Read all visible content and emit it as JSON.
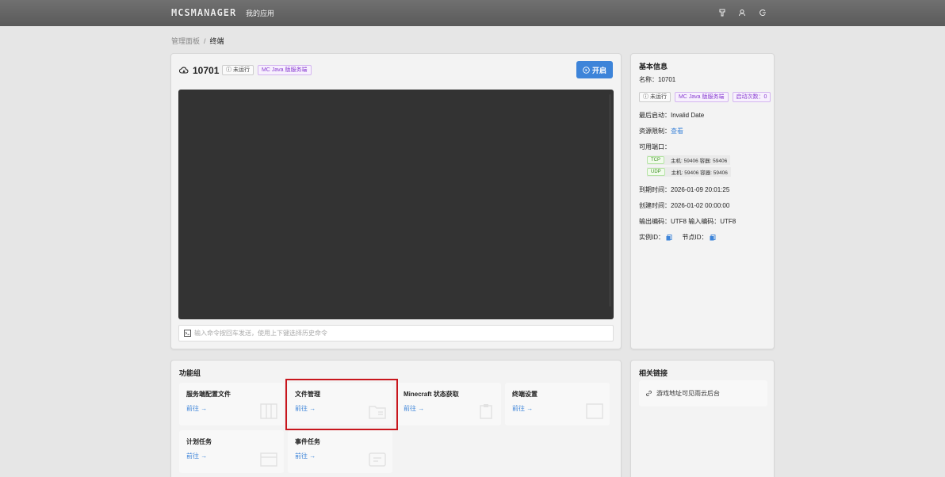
{
  "header": {
    "logo": "MCSMANAGER",
    "nav_apps": "我的应用"
  },
  "breadcrumb": {
    "root": "管理面板",
    "sep": "/",
    "current": "终端"
  },
  "instance": {
    "name": "10701",
    "status": "未运行",
    "type": "MC Java 版服务端",
    "start_label": "开启",
    "command_placeholder": "输入命令按回车发送，使用上下键选择历史命令"
  },
  "info": {
    "title": "基本信息",
    "name_line": "名称：10701",
    "status": "未运行",
    "type": "MC Java 版服务端",
    "start_count": "启动次数：0",
    "last_start": "最后启动：Invalid Date",
    "resource_label": "资源限制：",
    "resource_link": "查看",
    "ports_label": "可用端口：",
    "ports": [
      {
        "proto": "TCP",
        "desc": "主机: 59406 容器: 59406"
      },
      {
        "proto": "UDP",
        "desc": "主机: 59406 容器: 59406"
      }
    ],
    "expire": "到期时间：2026-01-09 20:01:25",
    "created": "创建时间：2026-01-02 00:00:00",
    "encoding": "输出编码：UTF8  输入编码：UTF8",
    "instance_id": "实例ID：",
    "node_id": "节点ID："
  },
  "features": {
    "title": "功能组",
    "go_label": "前往 →",
    "items": [
      {
        "title": "服务端配置文件",
        "icon": "columns-icon"
      },
      {
        "title": "文件管理",
        "icon": "folder-icon"
      },
      {
        "title": "Minecraft 状态获取",
        "icon": "clipboard-icon"
      },
      {
        "title": "终端设置",
        "icon": "square-icon"
      },
      {
        "title": "计划任务",
        "icon": "calendar-icon"
      },
      {
        "title": "事件任务",
        "icon": "event-icon"
      }
    ]
  },
  "links": {
    "title": "相关链接",
    "item": "游戏地址可见雨云后台"
  },
  "colors": {
    "accent": "#3d84d9",
    "highlight": "#c8161d",
    "terminal_bg": "#333333"
  }
}
